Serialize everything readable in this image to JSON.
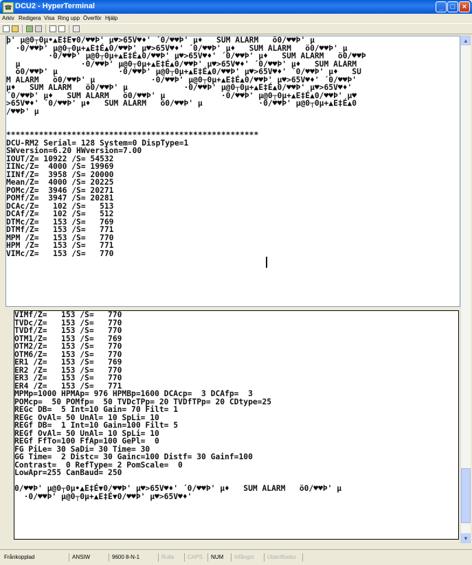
{
  "window": {
    "title": "DCU2 - HyperTerminal"
  },
  "menu": [
    "Arkiv",
    "Redigera",
    "Visa",
    "Ring upp",
    "Överför",
    "Hjälp"
  ],
  "terminal_top": [
    "þ' µ@0┬0µ•▲E‡É▼0/♥♥Þ' µ♥>65V♥♦' ´0/♥♥Þ' µ♦   SUM ALARM   ö0/♥♥Þ' µ",
    "  ·0/♥♥Þ' µ@0┬0µ+▲E‡É▲0/♥♥Þ' µ♥>65V♥♦' ´0/♥♥Þ' µ♦   SUM ALARM   ö0/♥♥Þ' µ",
    "         ·0/♥♥Þ' µ@0┬0µ+▲E‡É▲0/♥♥Þ' µ♥>65V♥♦' ´0/♥♥Þ' µ♦   SUM ALARM   ö0/♥♥Þ",
    "  µ             ·0/♥♥Þ' µ@0┬0µ+▲E‡É▲0/♥♥Þ' µ♥>65V♥♦' ´0/♥♥Þ' µ♦   SUM ALARM",
    "  ö0/♥♥Þ' µ             ·0/♥♥Þ' µ@0┬0µ+▲E‡É▲0/♥♥Þ' µ♥>65V♥♦' ´0/♥♥Þ' µ♦   SU",
    "M ALARM   ö0/♥♥Þ' µ            ·0/♥♥Þ' µ@0┬0µ+▲E‡É▲0/♥♥Þ' µ♥>65V♥♦' ´0/♥♥Þ'",
    "µ♦   SUM ALARM   ö0/♥♥Þ' µ            ·0/♥♥Þ' µ@0┬0µ+▲E‡É▲0/♥♥Þ' µ♥>65V♥♦'",
    "´0/♥♥Þ' µ♦   SUM ALARM   ö0/♥♥Þ' µ            ·0/♥♥Þ' µ@0┬0µ+▲E‡É▲0/♥♥Þ' µ♥",
    ">65V♥♦' ´0/♥♥Þ' µ♦   SUM ALARM   ö0/♥♥Þ' µ            ·0/♥♥Þ' µ@0┬0µ+▲E‡É▲0",
    "/♥♥Þ' µ",
    "",
    "",
    "******************************************************",
    "DCU-RM2 Serial= 128 System=0 DispType=1",
    "SWversion=6.20 HWversion=7.00",
    "IOUT/Z= 10922 /S= 54532",
    "IINc/Z=  4000 /S= 19969",
    "IINf/Z=  3958 /S= 20000",
    "Mean/Z=  4000 /S= 20225",
    "POMc/Z=  3946 /S= 20271",
    "POMf/Z=  3947 /S= 20281",
    "DCAc/Z=   102 /S=   513",
    "DCAf/Z=   102 /S=   512",
    "DTMc/Z=   153 /S=   769",
    "DTMf/Z=   153 /S=   771",
    "MPM /Z=   153 /S=   770",
    "HPM /Z=   153 /S=   771",
    "VIMc/Z=   153 /S=   770"
  ],
  "terminal_bottom": [
    "VIMf/Z=   153 /S=   770",
    "TVDc/Z=   153 /S=   770",
    "TVDf/Z=   153 /S=   770",
    "OTM1/Z=   153 /S=   769",
    "OTM2/Z=   153 /S=   770",
    "OTM6/Z=   153 /S=   770",
    "ER1 /Z=   153 /S=   769",
    "ER2 /Z=   153 /S=   770",
    "ER3 /Z=   153 /S=   770",
    "ER4 /Z=   153 /S=   771",
    "MPMp=1000 HPMAp= 976 HPMBp=1600 DCAcp=  3 DCAfp=  3",
    "POMcp=  50 POMfp=  50 TVDcTPp= 20 TVDfTPp= 20 CDtype=25",
    "REGc DB=  5 Int=10 Gain= 70 Filt= 1",
    "REGc OvAl= 50 UnAl= 10 SpLi= 10",
    "REGf DB=  1 Int=10 Gain=100 Filt= 5",
    "REGf OvAl= 50 UnAl= 10 SpLi= 10",
    "REGf FfTo=100 FfAp=100 GePl=  0",
    "FG PiLe= 30 SaDi= 30 Time= 30",
    "GG Time=  2 Distc= 30 Gainc=100 Distf= 30 Gainf=100",
    "Contrast=  0 RefType= 2 PomScale=  0",
    "LowApr=255 CanBaud= 250",
    "",
    "0/♥♥Þ' µ@0┬0µ•▲E‡É▼0/♥♥Þ' µ♥>65V♥♦' ´0/♥♥Þ' µ♦   SUM ALARM   ö0/♥♥Þ' µ",
    "  ·0/♥♥Þ' µ@0┬0µ+▲E‡É▼0/♥♥Þ' µ♥>65V♥♦'"
  ],
  "status": {
    "connection": "Frånkopplad",
    "emulation": "ANSIW",
    "port": "9600 8-N-1",
    "scroll": "Rulla",
    "caps": "CAPS",
    "num": "NUM",
    "capture": "Infångst",
    "echo": "Utskriftseko"
  }
}
